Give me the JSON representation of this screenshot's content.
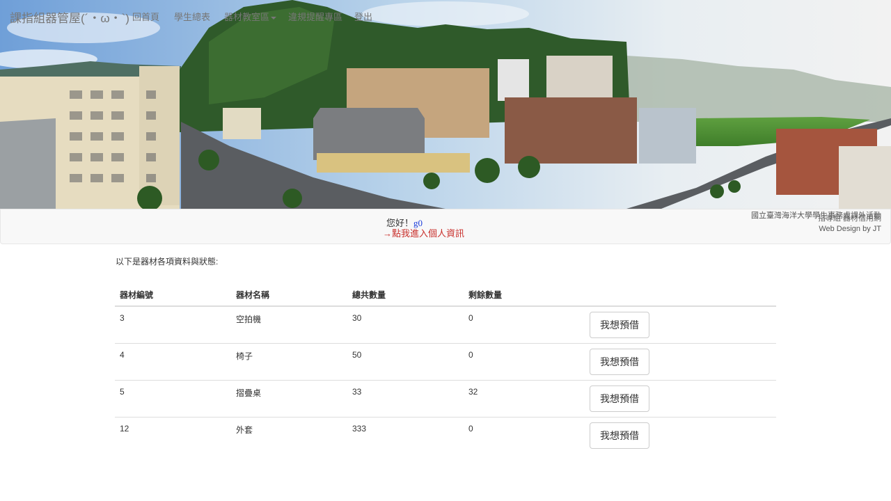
{
  "navbar": {
    "brand": "課指組器管屋(´・ω・`)",
    "links": {
      "home": "回首頁",
      "student_table": "學生總表",
      "equipment_area": "器材教室區",
      "violation_area": "違規提醒專區",
      "logout": "登出"
    },
    "greeting": "您好！",
    "username": "g0",
    "profile_link": "→點我進入個人資訊",
    "credits": {
      "org": "國立臺灣海洋大學學生事務處課外活動",
      "org_overlap": "指導組 器材借用網",
      "designer": "Web Design by JT"
    }
  },
  "main": {
    "intro": "以下是器材各項資料與狀態:",
    "columns": [
      "器材編號",
      "器材名稱",
      "總共數量",
      "剩餘數量"
    ],
    "rows": [
      {
        "id": "3",
        "name": "空拍機",
        "total": "30",
        "remaining": "0",
        "button": "我想預借"
      },
      {
        "id": "4",
        "name": "椅子",
        "total": "50",
        "remaining": "0",
        "button": "我想預借"
      },
      {
        "id": "5",
        "name": "摺疊桌",
        "total": "33",
        "remaining": "32",
        "button": "我想預借"
      },
      {
        "id": "12",
        "name": "外套",
        "total": "333",
        "remaining": "0",
        "button": "我想預借"
      }
    ]
  },
  "colors": {
    "navbar_bg": "#f8f8f8",
    "profile_link": "#c9302c",
    "username": "#1a3bdb"
  }
}
